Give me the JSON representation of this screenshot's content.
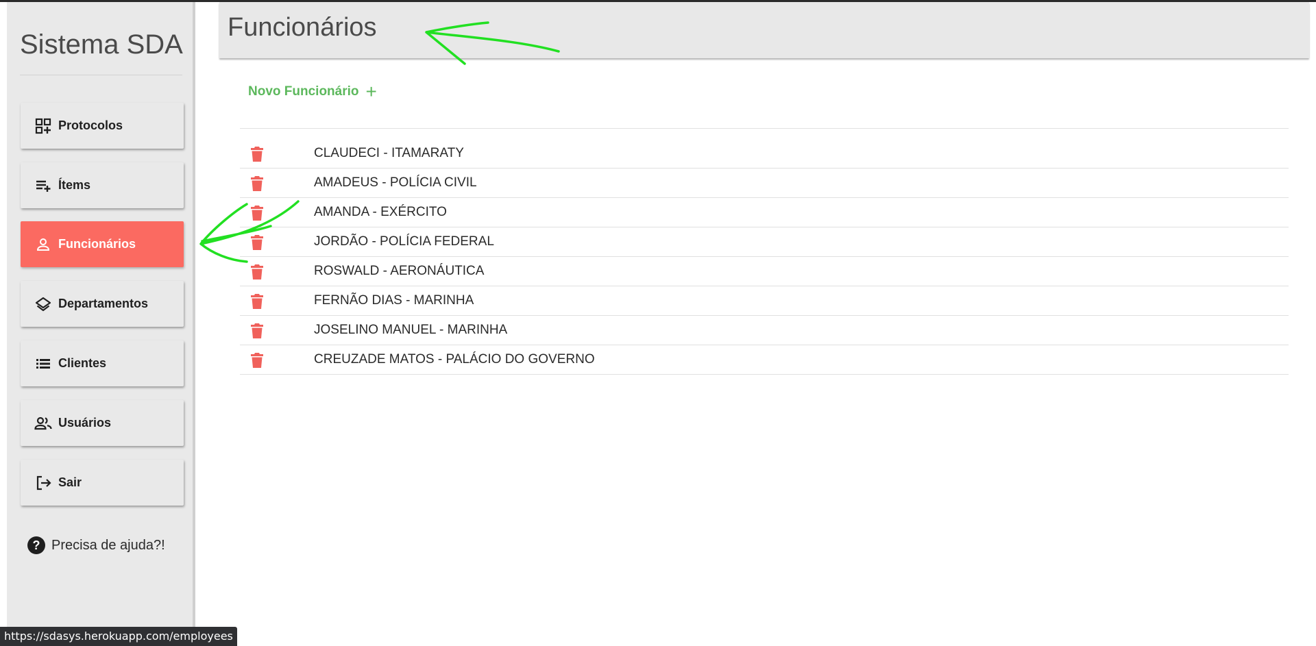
{
  "sidebar": {
    "brand": "Sistema SDA",
    "items": [
      {
        "label": "Protocolos",
        "icon": "grid-plus-icon",
        "active": false
      },
      {
        "label": "Ítems",
        "icon": "playlist-add-icon",
        "active": false
      },
      {
        "label": "Funcionários",
        "icon": "person-icon",
        "active": true
      },
      {
        "label": "Departamentos",
        "icon": "layers-icon",
        "active": false
      },
      {
        "label": "Clientes",
        "icon": "list-icon",
        "active": false
      },
      {
        "label": "Usuários",
        "icon": "people-icon",
        "active": false
      },
      {
        "label": "Sair",
        "icon": "logout-icon",
        "active": false
      }
    ],
    "help_label": "Precisa de ajuda?!"
  },
  "header": {
    "title": "Funcionários"
  },
  "main": {
    "new_button_label": "Novo Funcionário",
    "new_button_icon": "plus-icon",
    "employees": [
      "CLAUDECI - ITAMARATY",
      "AMADEUS - POLÍCIA CIVIL",
      "AMANDA - EXÉRCITO",
      "JORDÃO - POLÍCIA FEDERAL",
      "ROSWALD - AERONÁUTICA",
      "FERNÃO DIAS - MARINHA",
      "JOSELINO MANUEL - MARINHA",
      "CREUZADE MATOS - PALÁCIO DO GOVERNO"
    ]
  },
  "status_bar": {
    "url": "https://sdasys.herokuapp.com/employees"
  },
  "colors": {
    "accent": "#fb6a61",
    "success": "#5cb85c",
    "delete": "#f0615b",
    "sidebar_bg": "#e9e9e9",
    "header_bg": "#e8e8e8",
    "annotation": "#22e022"
  }
}
